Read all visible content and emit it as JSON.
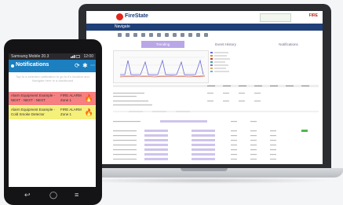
{
  "laptop": {
    "app_logo": "FireState",
    "brand_right": "FIRE",
    "nav_item": "Navigate",
    "tabs": [
      "Trending",
      "Event History",
      "Notifications"
    ],
    "accent": "#b9a6e6",
    "nav_color": "#1f3f78"
  },
  "phone": {
    "status_left": "Samsung Mobile 20.3",
    "status_time": "12:00",
    "app_title": "Notifications",
    "refresh_icon": "refresh-icon",
    "settings_icon": "gear-icon",
    "info_text": "Tap to a selected notification to go to it's location and Navigate here in a dashboard",
    "notifications": [
      {
        "main": "Alarm Equipment Example - NEXT - NEXT - NEXT",
        "alarm": "FIRE ALARM Zone 1",
        "icon": "fire-icon",
        "color": "#f57f81"
      },
      {
        "main": "Alarm Equipment Example - Cold Smoke Detector",
        "alarm": "FIRE ALARM Zone 1",
        "icon": "fire-icon",
        "color": "#f5f07a"
      }
    ],
    "nav": {
      "back": "↩",
      "home": "◯",
      "menu": "≡"
    }
  }
}
